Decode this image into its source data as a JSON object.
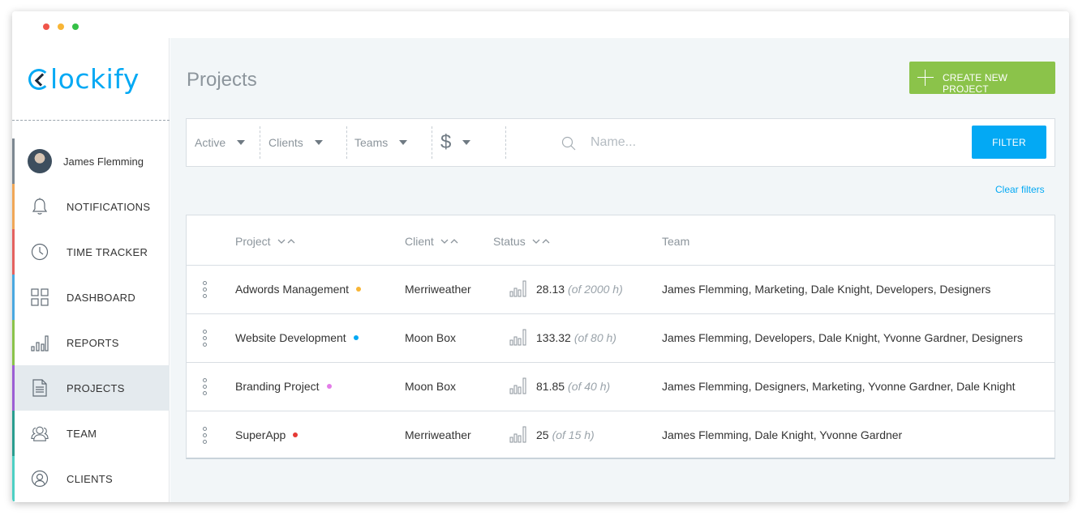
{
  "window": {
    "controls": [
      "close",
      "minimize",
      "maximize"
    ]
  },
  "sidebar": {
    "logo": "lockify",
    "user": {
      "name": "James Flemming"
    },
    "items": [
      {
        "label": "NOTIFICATIONS",
        "icon": "bell-icon",
        "accent": "#f0a757"
      },
      {
        "label": "TIME TRACKER",
        "icon": "clock-icon",
        "accent": "#e4625f"
      },
      {
        "label": "DASHBOARD",
        "icon": "grid-icon",
        "accent": "#4aa8e0"
      },
      {
        "label": "REPORTS",
        "icon": "bar-chart-icon",
        "accent": "#8bc34a"
      },
      {
        "label": "PROJECTS",
        "icon": "document-icon",
        "accent": "#9c5fd4",
        "active": true
      },
      {
        "label": "TEAM",
        "icon": "team-icon",
        "accent": "#2a9d8f"
      },
      {
        "label": "CLIENTS",
        "icon": "client-icon",
        "accent": "#4dd0c4"
      }
    ],
    "user_accent": "#7d8891"
  },
  "main": {
    "title": "Projects",
    "create_button": "CREATE NEW PROJECT",
    "filters": {
      "status": "Active",
      "clients": "Clients",
      "teams": "Teams",
      "billable": "$",
      "search_placeholder": "Name...",
      "filter_button": "FILTER",
      "clear": "Clear filters"
    },
    "table": {
      "columns": {
        "project": "Project",
        "client": "Client",
        "status": "Status",
        "team": "Team"
      },
      "rows": [
        {
          "project": "Adwords Management",
          "color": "#f8b535",
          "client": "Merriweather",
          "hours": "28.13",
          "of": "(of 2000 h)",
          "team": "James Flemming, Marketing, Dale Knight, Developers, Designers"
        },
        {
          "project": "Website Development",
          "color": "#03a9f4",
          "client": "Moon Box",
          "hours": "133.32",
          "of": "(of 80 h)",
          "team": "James Flemming, Developers, Dale Knight, Yvonne Gardner, Designers"
        },
        {
          "project": "Branding Project",
          "color": "#e37ce8",
          "client": "Moon Box",
          "hours": "81.85",
          "of": "(of 40 h)",
          "team": "James Flemming, Designers, Marketing, Yvonne Gardner, Dale Knight"
        },
        {
          "project": "SuperApp",
          "color": "#e53935",
          "client": "Merriweather",
          "hours": "25",
          "of": "(of 15 h)",
          "team": "James Flemming, Dale Knight, Yvonne Gardner"
        }
      ]
    }
  }
}
